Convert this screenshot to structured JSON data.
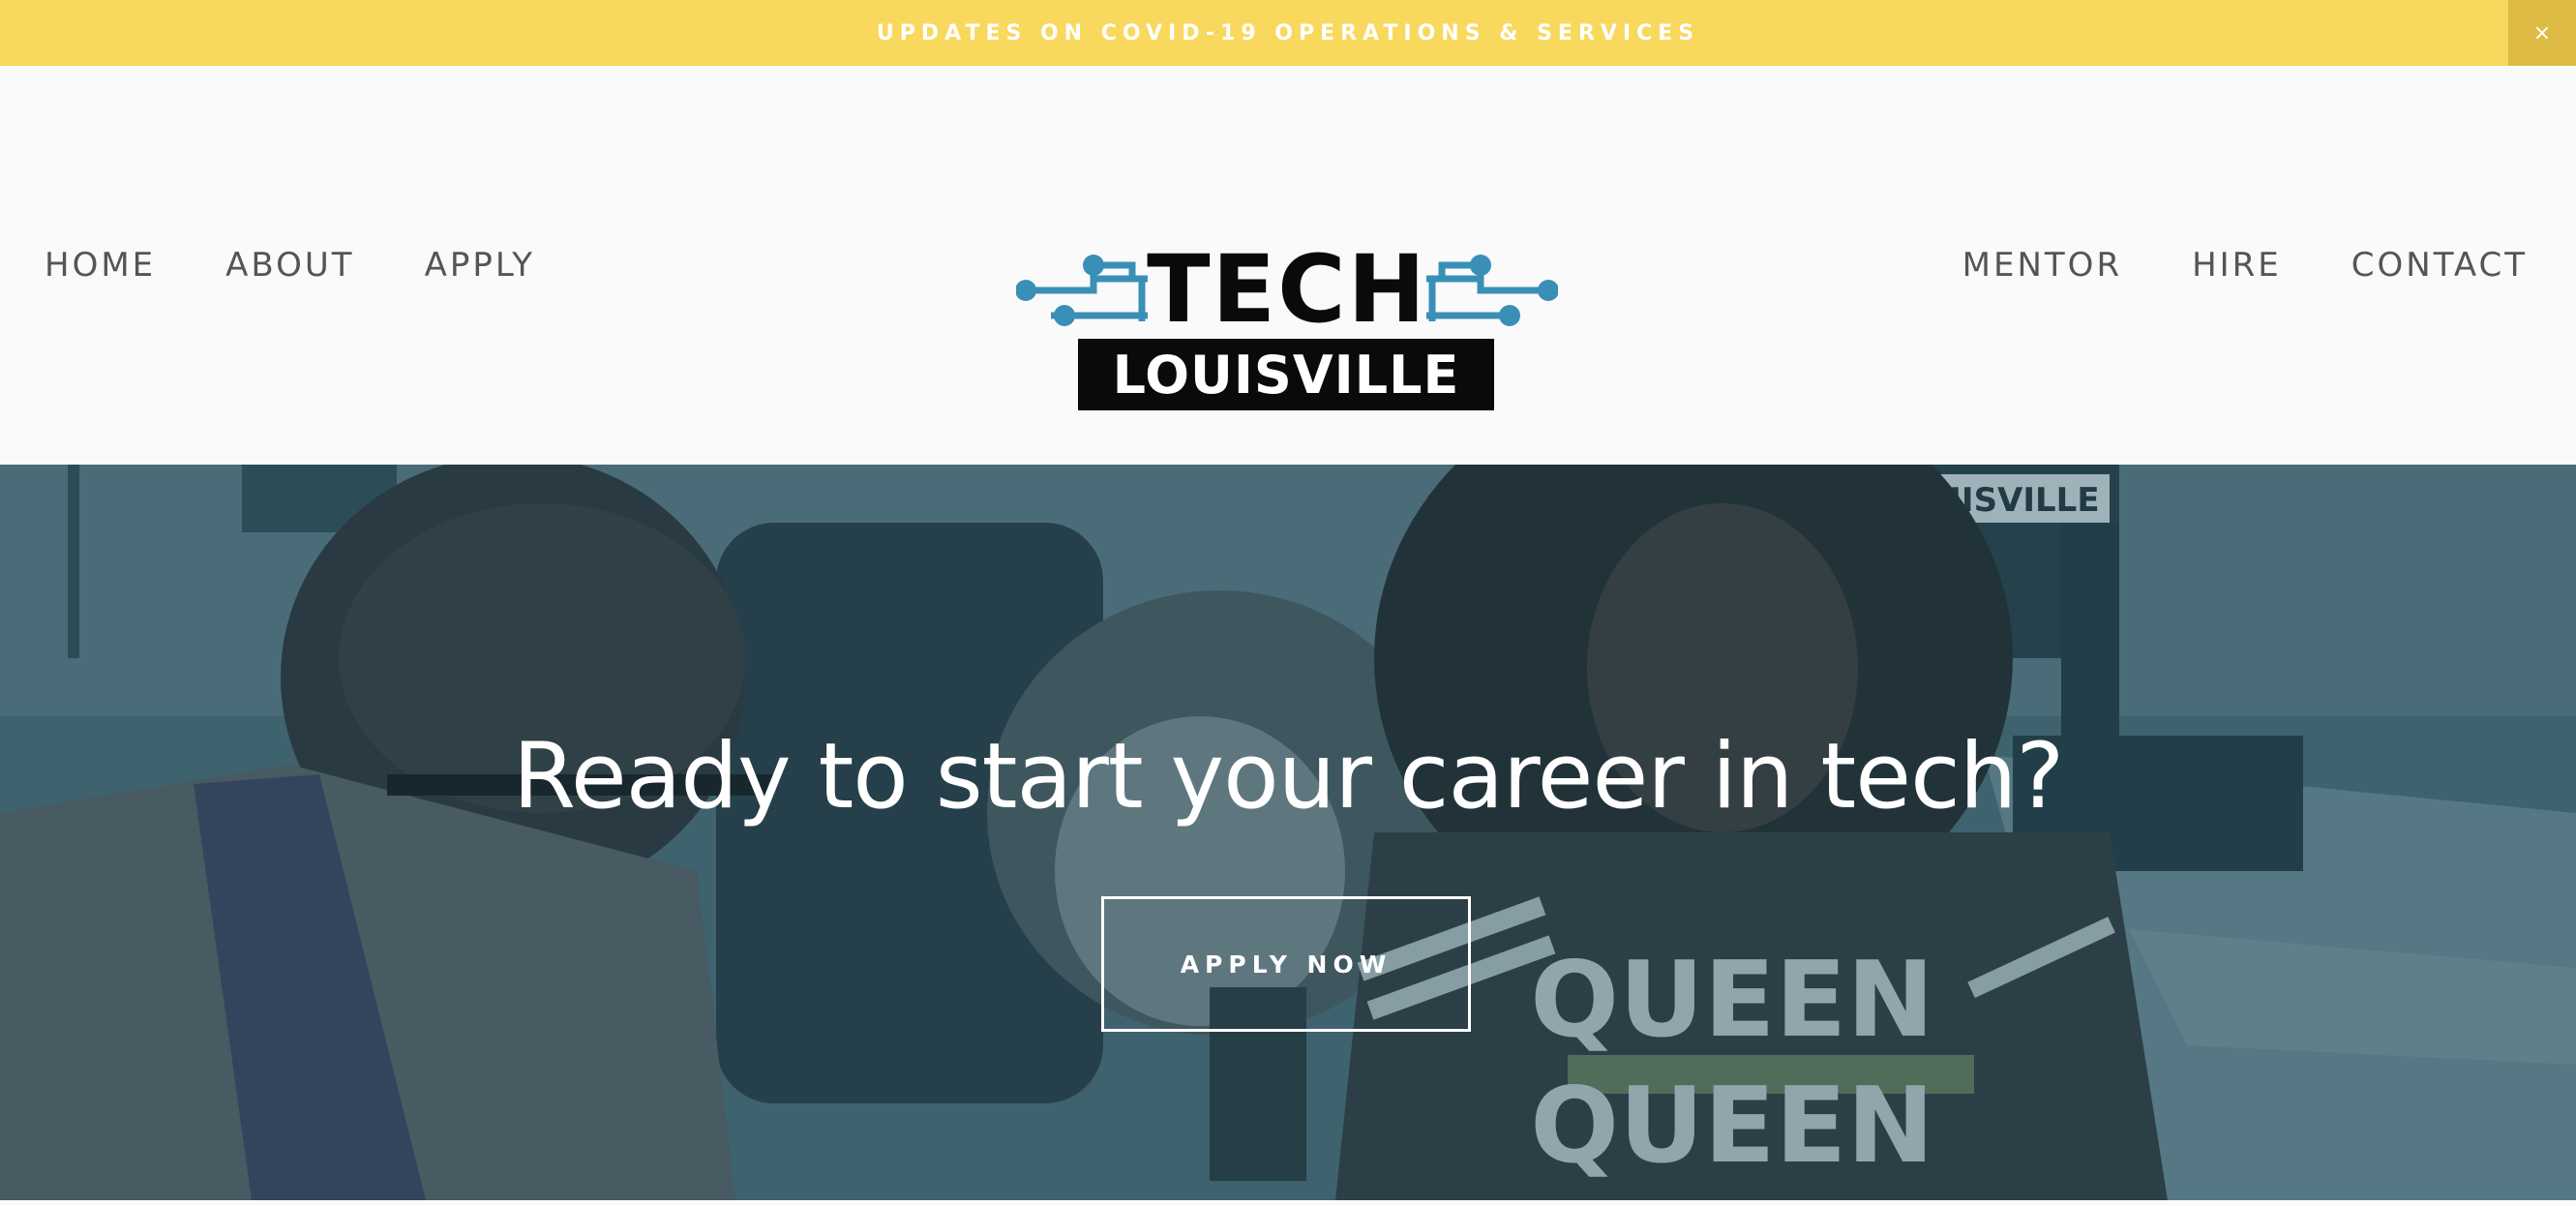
{
  "announcement": {
    "text": "UPDATES ON COVID-19 OPERATIONS & SERVICES",
    "close_label": "×"
  },
  "nav": {
    "left": [
      {
        "label": "HOME"
      },
      {
        "label": "ABOUT"
      },
      {
        "label": "APPLY"
      }
    ],
    "right": [
      {
        "label": "MENTOR"
      },
      {
        "label": "HIRE"
      },
      {
        "label": "CONTACT"
      }
    ]
  },
  "logo": {
    "line1": "TECH",
    "line2": "LOUISVILLE",
    "accent_color": "#3a8fb7"
  },
  "hero": {
    "title": "Ready to start your career in tech?",
    "button_label": "APPLY NOW",
    "sign_text": "OUISVILLE",
    "shirt_text": "QUEEN"
  },
  "colors": {
    "announcement_bg": "#f9d85e",
    "close_bg": "#ddbb45",
    "header_bg": "#fafafa",
    "nav_text": "#555555",
    "hero_tint": "#3e5e69"
  }
}
